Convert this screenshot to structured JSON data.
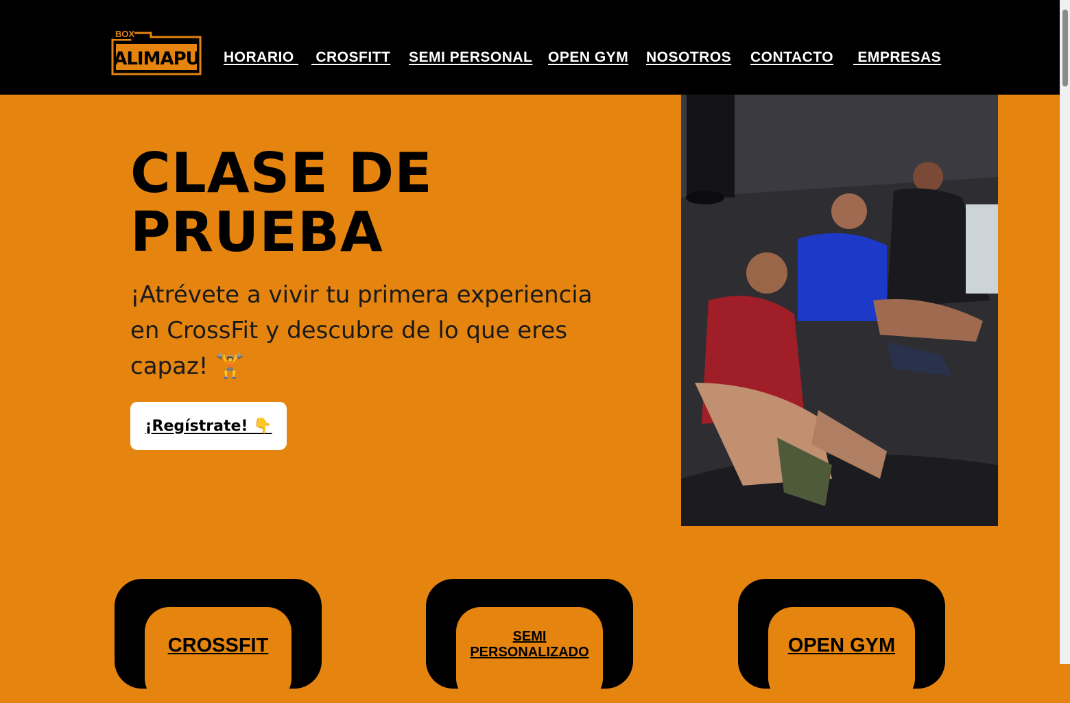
{
  "brand": {
    "logo_top": "BOX",
    "logo_main": "ALIMAPU",
    "logo_color": "#e5840f"
  },
  "nav": {
    "items": [
      "HORARIO ",
      " CROSFITT",
      "SEMI PERSONAL",
      "OPEN GYM",
      "NOSOTROS",
      "CONTACTO",
      " EMPRESAS"
    ]
  },
  "hero": {
    "title_line1": "CLASE DE",
    "title_line2": "PRUEBA",
    "description": " ¡Atrévete a vivir tu primera experiencia en CrossFit y descubre de lo que eres capaz! 🏋️",
    "cta_label": "¡Regístrate! 👇"
  },
  "cards": [
    {
      "label": "CROSSFIT"
    },
    {
      "label_line1": "SEMI",
      "label_line2": "PERSONALIZADO"
    },
    {
      "label": "OPEN GYM"
    }
  ],
  "colors": {
    "accent_orange": "#e5840f",
    "header_black": "#000000",
    "button_white": "#ffffff"
  }
}
